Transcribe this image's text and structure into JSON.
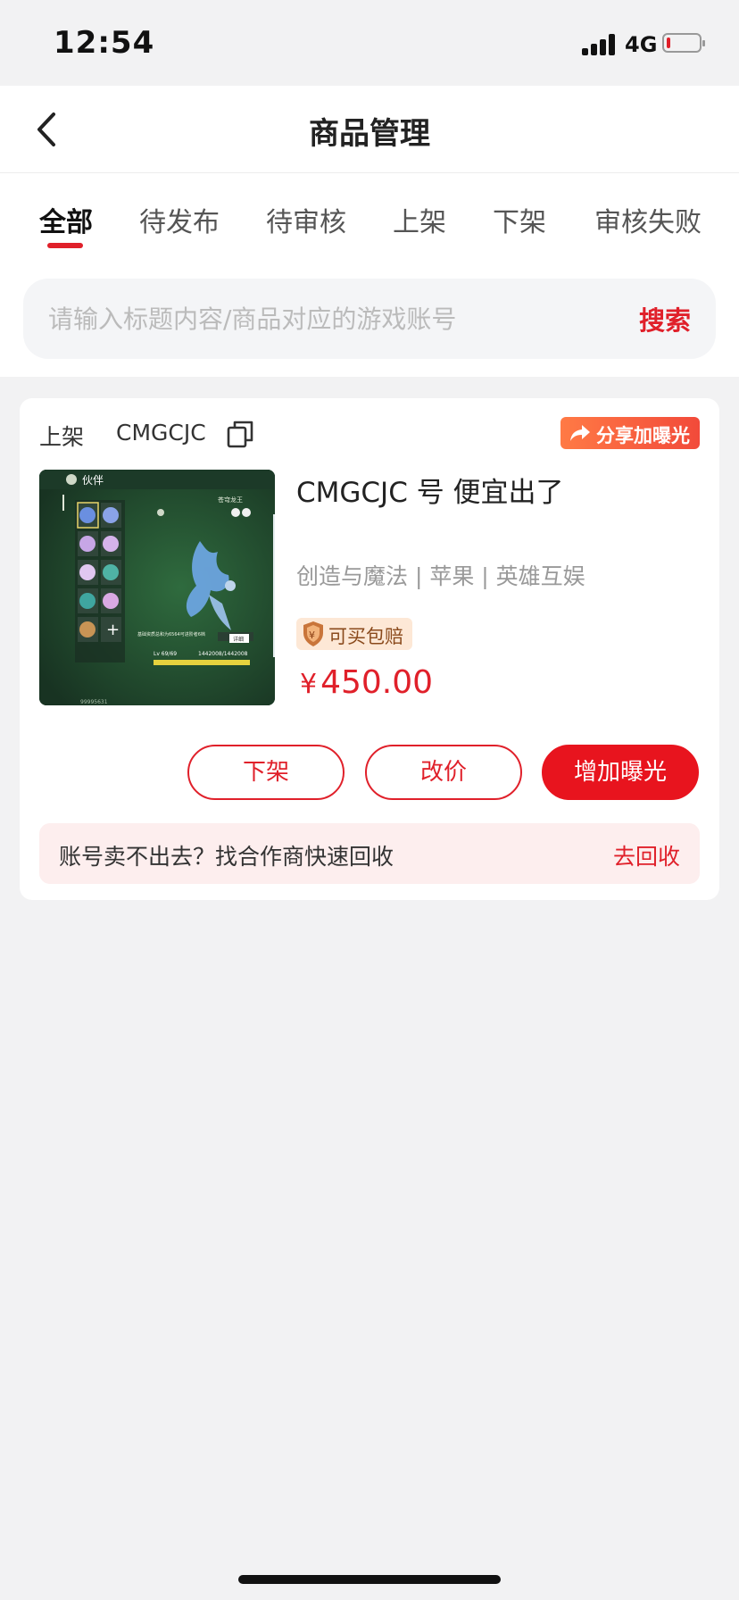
{
  "status_bar": {
    "time": "12:54",
    "network": "4G"
  },
  "header": {
    "title": "商品管理"
  },
  "tabs": [
    {
      "label": "全部",
      "active": true
    },
    {
      "label": "待发布"
    },
    {
      "label": "待审核"
    },
    {
      "label": "上架"
    },
    {
      "label": "下架"
    },
    {
      "label": "审核失败"
    }
  ],
  "search": {
    "placeholder": "请输入标题内容/商品对应的游戏账号",
    "button": "搜索"
  },
  "listing": {
    "status": "上架",
    "code": "CMGCJC",
    "share_label": "分享加曝光",
    "title": "CMGCJC 号 便宜出了",
    "subtitle": "创造与魔法 | 苹果 | 英雄互娱",
    "guarantee_label": "可买包赔",
    "price_symbol": "¥",
    "price": "450.00",
    "thumbnail": {
      "panel_title": "伙伴",
      "pet_name": "苍穹龙王",
      "detail_button": "详细",
      "level_text": "Lv 69/69",
      "hp_text": "1442008/1442008",
      "footer_id": "99995631"
    },
    "buttons": {
      "delist": "下架",
      "reprice": "改价",
      "boost": "增加曝光"
    },
    "recycle": {
      "text": "账号卖不出去？找合作商快速回收",
      "link": "去回收"
    }
  },
  "colors": {
    "accent": "#e0202a",
    "background": "#f2f2f3"
  }
}
